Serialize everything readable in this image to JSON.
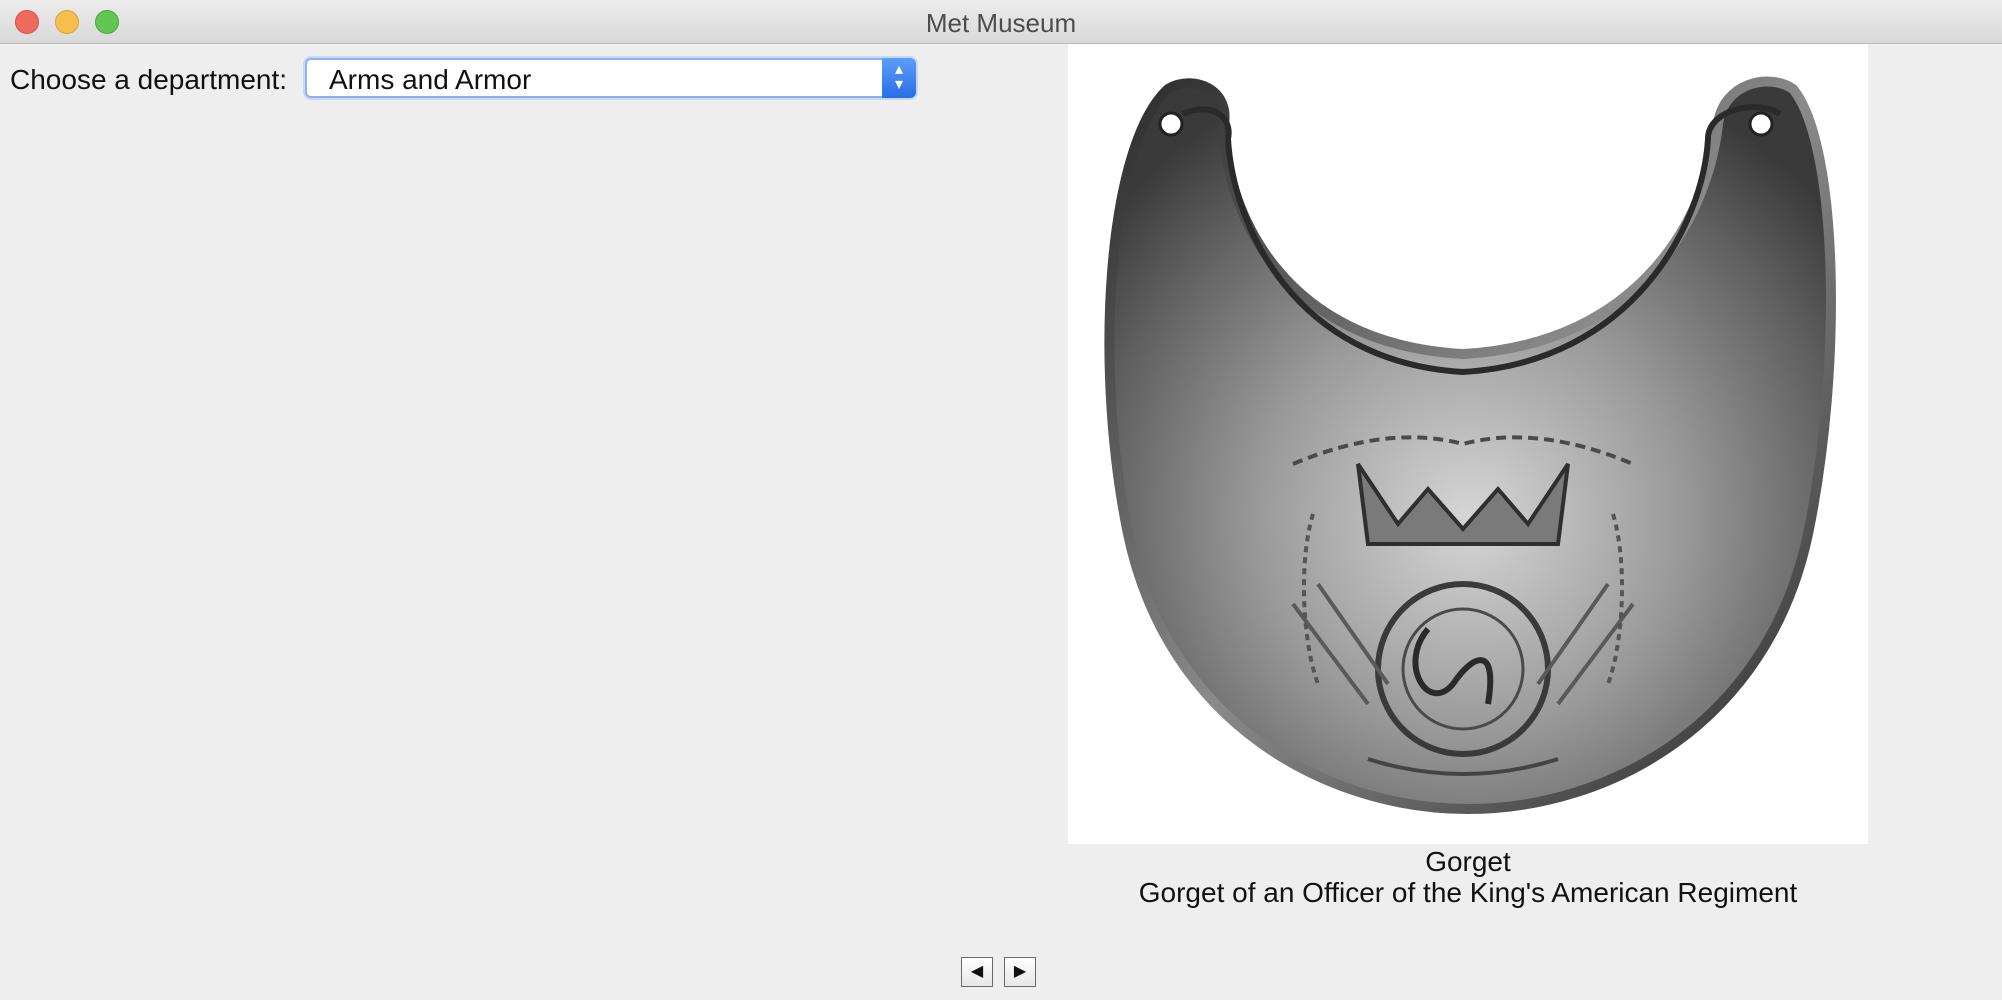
{
  "window": {
    "title": "Met Museum"
  },
  "department": {
    "label": "Choose a department:",
    "selected": "Arms and Armor"
  },
  "artwork": {
    "title": "Gorget",
    "description": "Gorget of an Officer of the King's American Regiment",
    "image_subject": "gorget-photo"
  },
  "navigation": {
    "prev_glyph": "◀",
    "next_glyph": "▶"
  },
  "colors": {
    "window_bg": "#eeeeee",
    "select_accent": "#2a6de6",
    "close": "#ee6a5f",
    "minimize": "#f5be4f",
    "maximize": "#62c554"
  }
}
